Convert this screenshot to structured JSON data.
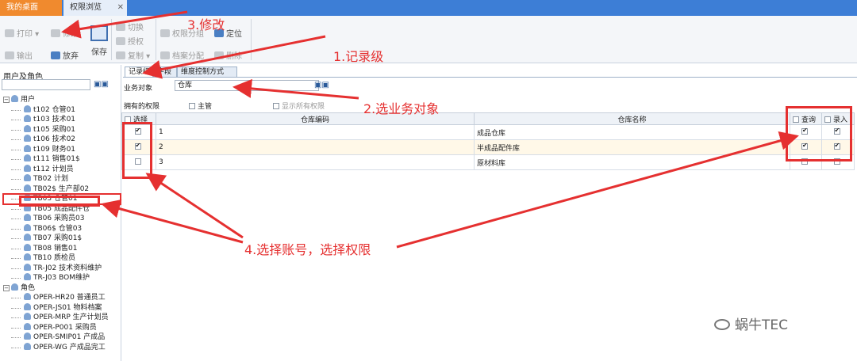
{
  "tabs": [
    {
      "label": "我的桌面"
    },
    {
      "label": "权限浏览",
      "close": "✕"
    }
  ],
  "toolbar": {
    "print": "打印",
    "modify": "修改",
    "output": "输出",
    "discard": "放弃",
    "save": "保存",
    "switch": "切换",
    "authorize": "授权",
    "copy": "复制",
    "perm_group": "权限分组",
    "archive_assign": "档案分配",
    "locate": "定位",
    "delete": "删除"
  },
  "left_panel": {
    "title": "用户及角色",
    "search_value": "",
    "users_label": "用户",
    "users": [
      "t102   仓管01",
      "t103   技术01",
      "t105   采购01",
      "t106   技术02",
      "t109   财务01",
      "t111   销售01$",
      "t112   计划员",
      "TB02   计划",
      "TB02$   生产部02",
      "TB03   仓管01",
      "TB05   成品配件仓",
      "TB06   采购员03",
      "TB06$   仓管03",
      "TB07   采购01$",
      "TB08   销售01",
      "TB10   质检员",
      "TR-J02   技术资料维护",
      "TR-J03   BOM维护"
    ],
    "roles_label": "角色",
    "roles": [
      "OPER-HR20   普通员工",
      "OPER-JS01   物料档案",
      "OPER-MRP   生产计划员",
      "OPER-P001   采购员",
      "OPER-SMIP01   产成品",
      "OPER-WG   产成品完工"
    ]
  },
  "sub_tabs": [
    "记录级",
    "字段",
    "维度控制方式"
  ],
  "form": {
    "business_object_label": "业务对象",
    "business_object_value": "仓库",
    "owned_perm_label": "拥有的权限",
    "supervisor_label": "主管",
    "show_all_label": "显示所有权限"
  },
  "grid": {
    "headers": [
      "选择",
      "仓库编码",
      "仓库名称",
      "查询",
      "录入"
    ],
    "rows": [
      {
        "selected": true,
        "code": "1",
        "name": "成品仓库",
        "query": true,
        "entry": true
      },
      {
        "selected": true,
        "code": "2",
        "name": "半成品配件库",
        "query": true,
        "entry": true
      },
      {
        "selected": false,
        "code": "3",
        "name": "原材料库",
        "query": false,
        "entry": false
      }
    ]
  },
  "annotations": {
    "step1": "1.记录级",
    "step2": "2.选业务对象",
    "step3": "3.修改",
    "step4": "4.选择账号，选择权限",
    "color": "#e53030"
  },
  "watermark": "蜗牛TEC"
}
